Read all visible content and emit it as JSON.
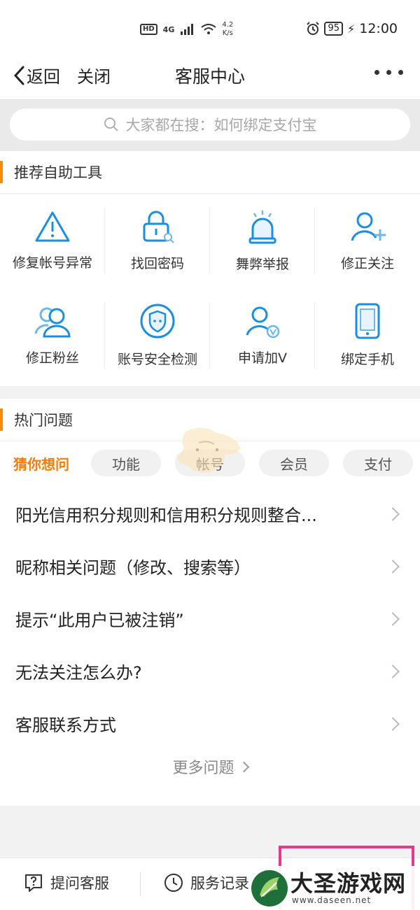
{
  "status_bar": {
    "hd": "HD",
    "network": "4G",
    "speed_value": "4.2",
    "speed_unit": "K/s",
    "battery": "95",
    "time": "12:00"
  },
  "nav": {
    "back_label": "返回",
    "close_label": "关闭",
    "title": "客服中心"
  },
  "search": {
    "placeholder": "大家都在搜：如何绑定支付宝"
  },
  "tools": {
    "section_title": "推荐自助工具",
    "items": [
      {
        "label": "修复帐号异常",
        "icon": "warning-icon"
      },
      {
        "label": "找回密码",
        "icon": "lock-icon"
      },
      {
        "label": "舞弊举报",
        "icon": "alarm-icon"
      },
      {
        "label": "修正关注",
        "icon": "user-add-icon"
      },
      {
        "label": "修正粉丝",
        "icon": "users-icon"
      },
      {
        "label": "账号安全检测",
        "icon": "shield-icon"
      },
      {
        "label": "申请加V",
        "icon": "user-verified-icon"
      },
      {
        "label": "绑定手机",
        "icon": "phone-icon"
      }
    ],
    "accent": "#1a8fe0"
  },
  "hot": {
    "section_title": "热门问题",
    "accent": "#ff8a00",
    "chips": [
      "猜你想问",
      "功能",
      "帐号",
      "会员",
      "支付"
    ],
    "active_chip": "猜你想问",
    "questions": [
      "阳光信用积分规则和信用积分规则整合...",
      "昵称相关问题（修改、搜索等）",
      "提示“此用户已被注销”",
      "无法关注怎么办?",
      "客服联系方式"
    ],
    "more_label": "更多问题"
  },
  "footer": {
    "ask_label": "提问客服",
    "records_label": "服务记录"
  },
  "watermark": {
    "text": "大圣游戏网",
    "url": "www.daseen.net"
  }
}
